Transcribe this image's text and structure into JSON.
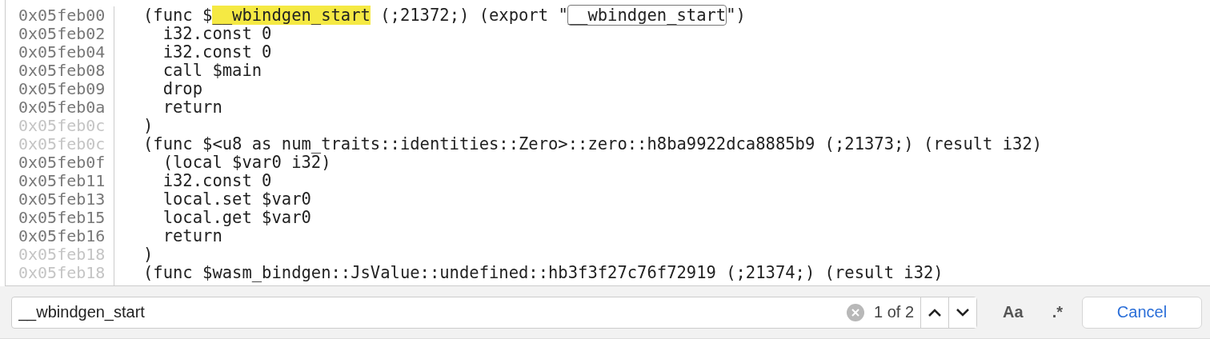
{
  "editor": {
    "lines": [
      {
        "address": "0x05feb00",
        "dim": false,
        "segments": [
          {
            "kind": "plain",
            "text": "(func $"
          },
          {
            "kind": "current-match",
            "text": "__wbindgen_start"
          },
          {
            "kind": "plain",
            "text": " (;21372;) (export \""
          },
          {
            "kind": "match",
            "text": "__wbindgen_start"
          },
          {
            "kind": "plain",
            "text": "\")"
          }
        ]
      },
      {
        "address": "0x05feb02",
        "dim": false,
        "segments": [
          {
            "kind": "plain",
            "text": "  i32.const 0"
          }
        ]
      },
      {
        "address": "0x05feb04",
        "dim": false,
        "segments": [
          {
            "kind": "plain",
            "text": "  i32.const 0"
          }
        ]
      },
      {
        "address": "0x05feb08",
        "dim": false,
        "segments": [
          {
            "kind": "plain",
            "text": "  call $main"
          }
        ]
      },
      {
        "address": "0x05feb09",
        "dim": false,
        "segments": [
          {
            "kind": "plain",
            "text": "  drop"
          }
        ]
      },
      {
        "address": "0x05feb0a",
        "dim": false,
        "segments": [
          {
            "kind": "plain",
            "text": "  return"
          }
        ]
      },
      {
        "address": "0x05feb0c",
        "dim": true,
        "segments": [
          {
            "kind": "plain",
            "text": ")"
          }
        ]
      },
      {
        "address": "0x05feb0c",
        "dim": true,
        "segments": [
          {
            "kind": "plain",
            "text": "(func $<u8 as num_traits::identities::Zero>::zero::h8ba9922dca8885b9 (;21373;) (result i32)"
          }
        ]
      },
      {
        "address": "0x05feb0f",
        "dim": false,
        "segments": [
          {
            "kind": "plain",
            "text": "  (local $var0 i32)"
          }
        ]
      },
      {
        "address": "0x05feb11",
        "dim": false,
        "segments": [
          {
            "kind": "plain",
            "text": "  i32.const 0"
          }
        ]
      },
      {
        "address": "0x05feb13",
        "dim": false,
        "segments": [
          {
            "kind": "plain",
            "text": "  local.set $var0"
          }
        ]
      },
      {
        "address": "0x05feb15",
        "dim": false,
        "segments": [
          {
            "kind": "plain",
            "text": "  local.get $var0"
          }
        ]
      },
      {
        "address": "0x05feb16",
        "dim": false,
        "segments": [
          {
            "kind": "plain",
            "text": "  return"
          }
        ]
      },
      {
        "address": "0x05feb18",
        "dim": true,
        "segments": [
          {
            "kind": "plain",
            "text": ")"
          }
        ]
      },
      {
        "address": "0x05feb18",
        "dim": true,
        "segments": [
          {
            "kind": "plain",
            "text": "(func $wasm_bindgen::JsValue::undefined::hb3f3f27c76f72919 (;21374;) (result i32)"
          }
        ]
      }
    ]
  },
  "find_bar": {
    "query": "__wbindgen_start",
    "match_count": "1 of 2",
    "match_case": {
      "label": "Aa",
      "on": false
    },
    "regex": {
      "label": ".*",
      "on": false
    },
    "cancel": "Cancel"
  }
}
